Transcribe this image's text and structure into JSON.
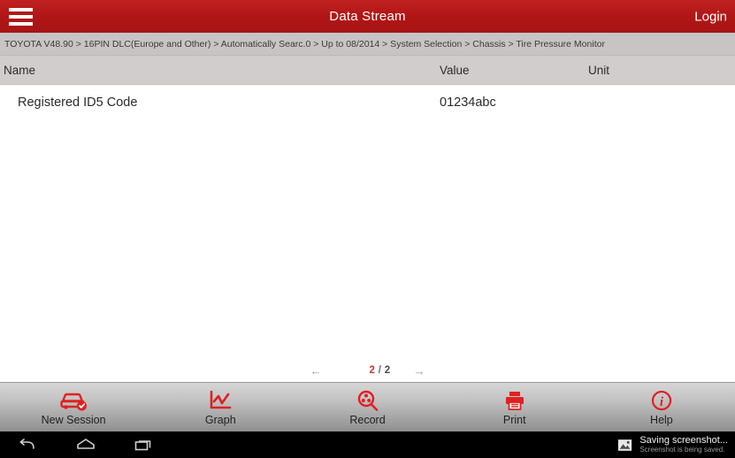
{
  "titlebar": {
    "menu_icon": "hamburger-menu-icon",
    "title": "Data Stream",
    "login_label": "Login",
    "background_color": "#b71c1c"
  },
  "breadcrumb": {
    "path": "TOYOTA V48.90 > 16PIN DLC(Europe and Other) > Automatically Searc.0 > Up to 08/2014 > System Selection > Chassis > Tire Pressure Monitor"
  },
  "table": {
    "columns": [
      "Name",
      "Value",
      "Unit"
    ],
    "rows": [
      {
        "name": "Registered ID5 Code",
        "value": "01234abc",
        "unit": ""
      }
    ]
  },
  "pagination": {
    "prev_icon": "arrow-left-icon",
    "next_icon": "arrow-right-icon",
    "current_page": "2",
    "separator": " / ",
    "total_pages": "2"
  },
  "toolbar": {
    "accent_color": "#e02020",
    "buttons": [
      {
        "label": "New Session",
        "icon": "car-check-icon"
      },
      {
        "label": "Graph",
        "icon": "line-chart-icon"
      },
      {
        "label": "Record",
        "icon": "record-search-icon"
      },
      {
        "label": "Print",
        "icon": "printer-icon"
      },
      {
        "label": "Help",
        "icon": "info-circle-icon"
      }
    ]
  },
  "navbar": {
    "back_icon": "back-arrow-icon",
    "home_icon": "home-icon",
    "recents_icon": "recent-apps-icon",
    "notification": {
      "icon": "image-icon",
      "title": "Saving screenshot...",
      "subtitle": "Screenshot is being saved."
    }
  }
}
